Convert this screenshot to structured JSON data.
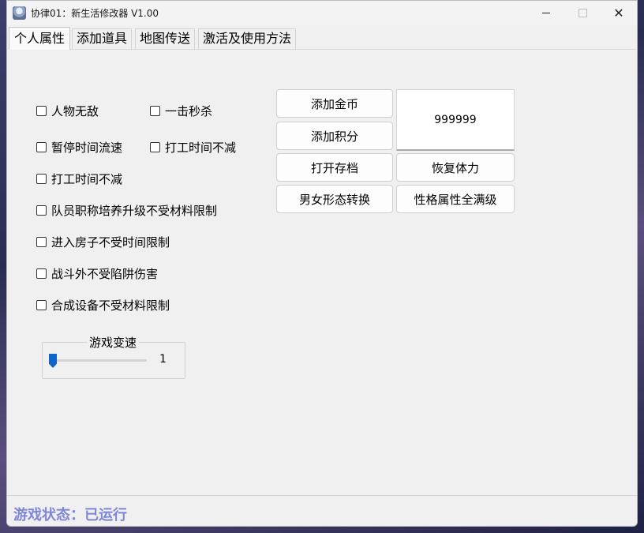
{
  "window": {
    "title": "协律01：新生活修改器 V1.00"
  },
  "tabs": [
    "个人属性",
    "添加道具",
    "地图传送",
    "激活及使用方法"
  ],
  "checkboxes": {
    "invincible": "人物无敌",
    "one_hit_kill": "一击秒杀",
    "pause_time": "暂停时间流速",
    "work_time_no_decrease_1": "打工时间不减",
    "work_time_no_decrease_2": "打工时间不减",
    "member_title_upgrade": "队员职称培养升级不受材料限制",
    "enter_house_no_limit": "进入房子不受时间限制",
    "no_trap_damage": "战斗外不受陷阱伤害",
    "craft_no_material": "合成设备不受材料限制"
  },
  "buttons": {
    "add_gold": "添加金币",
    "add_points": "添加积分",
    "open_save": "打开存档",
    "restore_stamina": "恢复体力",
    "gender_switch": "男女形态转换",
    "max_personality": "性格属性全满级"
  },
  "amount_value": "999999",
  "speed": {
    "title": "游戏变速",
    "value": "1"
  },
  "status": "游戏状态：已运行"
}
